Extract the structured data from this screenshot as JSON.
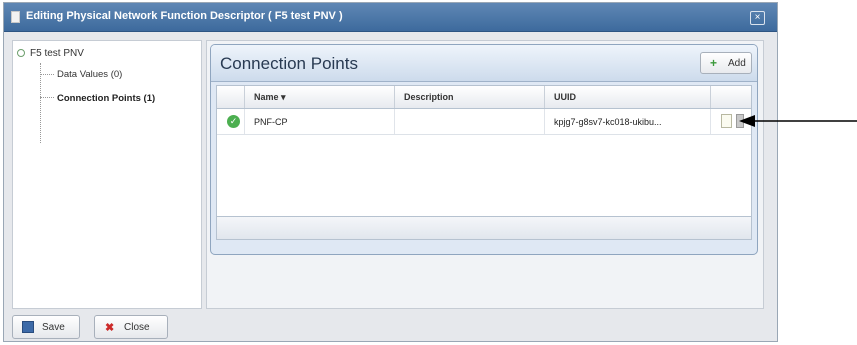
{
  "dialog": {
    "title": "Editing Physical Network Function Descriptor ( F5 test PNV )",
    "close_glyph": "×"
  },
  "tree": {
    "root": "F5 test PNV",
    "items": [
      {
        "label": "Data Values (0)"
      },
      {
        "label": "Connection Points (1)"
      }
    ]
  },
  "panel": {
    "title": "Connection Points",
    "add_label": "Add",
    "add_glyph": "+",
    "columns": [
      "",
      "Name ▾",
      "Description",
      "UUID",
      ""
    ],
    "rows": [
      {
        "status_icon": "check-circle-icon",
        "status_glyph": "✓",
        "name": "PNF-CP",
        "description": "",
        "uuid": "kpjg7-g8sv7-kc018-ukibu..."
      }
    ]
  },
  "footer": {
    "save_label": "Save",
    "close_label": "Close",
    "close_glyph": "✖"
  },
  "colors": {
    "title_bar": "#4a77aa",
    "panel_header": "#dbe6f3",
    "status_ok": "#4caf50"
  }
}
